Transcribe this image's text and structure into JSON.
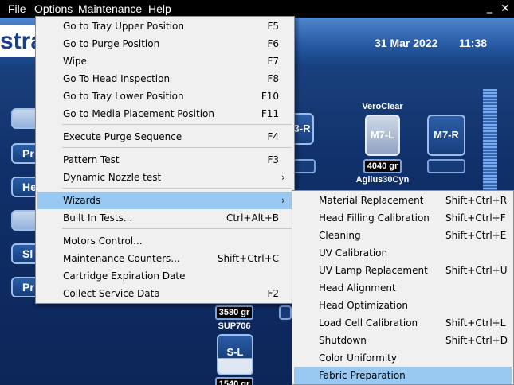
{
  "menubar": {
    "file": "File",
    "options": "Options",
    "maintenance": "Maintenance",
    "help": "Help",
    "minimize": "_",
    "close": "✕"
  },
  "app": {
    "logo_text": "stra",
    "date": "31 Mar 2022",
    "time": "11:38",
    "side_buttons": [
      "",
      "Pr",
      "He",
      "",
      "Sl",
      "Pr"
    ],
    "cartridges": {
      "veroclear_label": "VeroClear",
      "m7l": "M7-L",
      "m7r": "M7-R",
      "partial_r": "3-R",
      "m7l_weight": "4040 gr",
      "agilus_label": "Agilus30Cyn",
      "sup_weight": "3580 gr",
      "sup_label": "SUP706",
      "sl": "S-L",
      "sl_weight": "1540 gr"
    }
  },
  "maintenance_menu": {
    "items": [
      {
        "label": "Go to Tray Upper Position",
        "shortcut": "F5"
      },
      {
        "label": "Go to Purge Position",
        "shortcut": "F6"
      },
      {
        "label": "Wipe",
        "shortcut": "F7"
      },
      {
        "label": "Go To Head Inspection",
        "shortcut": "F8"
      },
      {
        "label": "Go to Tray Lower Position",
        "shortcut": "F10"
      },
      {
        "label": "Go to Media Placement Position",
        "shortcut": "F11"
      },
      {
        "label": "Execute Purge Sequence",
        "shortcut": "F4"
      },
      {
        "label": "Pattern Test",
        "shortcut": "F3"
      },
      {
        "label": "Dynamic Nozzle test",
        "shortcut": ""
      },
      {
        "label": "Wizards",
        "shortcut": ""
      },
      {
        "label": "Built In Tests...",
        "shortcut": "Ctrl+Alt+B"
      },
      {
        "label": "Motors Control...",
        "shortcut": ""
      },
      {
        "label": "Maintenance Counters...",
        "shortcut": "Shift+Ctrl+C"
      },
      {
        "label": "Cartridge Expiration Date",
        "shortcut": ""
      },
      {
        "label": "Collect Service Data",
        "shortcut": "F2"
      }
    ],
    "submenu_arrow": "›"
  },
  "wizards_menu": {
    "items": [
      {
        "label": "Material Replacement",
        "shortcut": "Shift+Ctrl+R"
      },
      {
        "label": "Head Filling Calibration",
        "shortcut": "Shift+Ctrl+F"
      },
      {
        "label": "Cleaning",
        "shortcut": "Shift+Ctrl+E"
      },
      {
        "label": "UV Calibration",
        "shortcut": ""
      },
      {
        "label": "UV Lamp Replacement",
        "shortcut": "Shift+Ctrl+U"
      },
      {
        "label": "Head Alignment",
        "shortcut": ""
      },
      {
        "label": "Head Optimization",
        "shortcut": ""
      },
      {
        "label": "Load Cell Calibration",
        "shortcut": "Shift+Ctrl+L"
      },
      {
        "label": "Shutdown",
        "shortcut": "Shift+Ctrl+D"
      },
      {
        "label": "Color Uniformity",
        "shortcut": ""
      },
      {
        "label": "Fabric Preparation",
        "shortcut": ""
      }
    ]
  }
}
